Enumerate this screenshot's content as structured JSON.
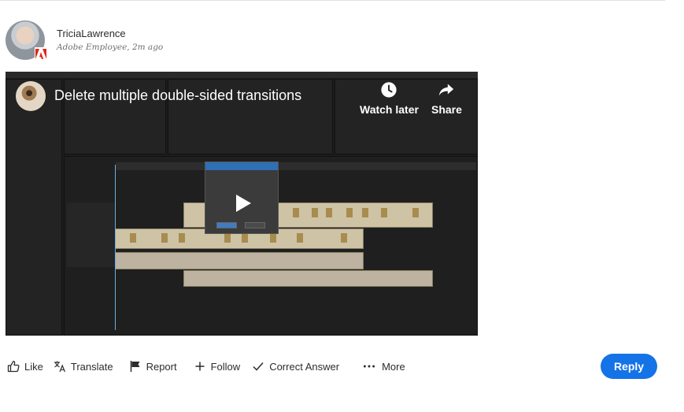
{
  "author": {
    "name": "TriciaLawrence",
    "subtitle": "Adobe Employee, 2m ago"
  },
  "video": {
    "title": "Delete multiple double-sided transitions",
    "watch_later_label": "Watch later",
    "share_label": "Share"
  },
  "actions": {
    "like": "Like",
    "translate": "Translate",
    "report": "Report",
    "follow": "Follow",
    "correct_answer": "Correct Answer",
    "more": "More",
    "reply": "Reply"
  },
  "colors": {
    "reply_button": "#1473e6",
    "adobe_badge": "#e1251b"
  },
  "icons": {
    "like": "thumbs-up-icon",
    "translate": "translate-icon",
    "report": "flag-icon",
    "follow": "plus-icon",
    "correct_answer": "checkmark-icon",
    "more": "ellipsis-icon",
    "watch_later": "clock-icon",
    "share": "share-arrow-icon",
    "play": "play-icon"
  }
}
